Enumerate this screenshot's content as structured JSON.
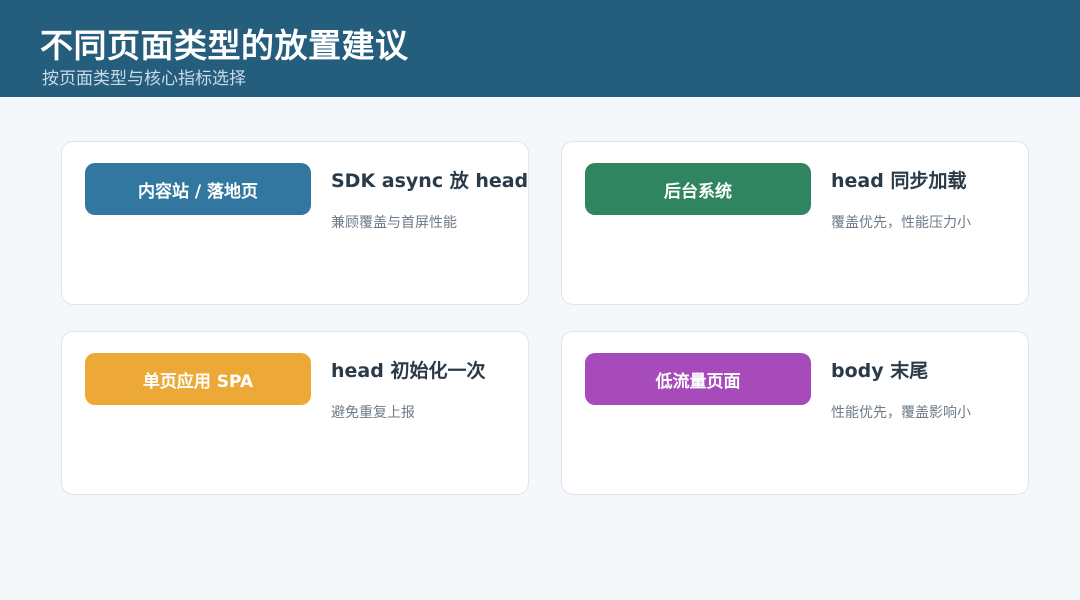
{
  "header": {
    "title": "不同页面类型的放置建议",
    "subtitle": "按页面类型与核心指标选择"
  },
  "cards": [
    {
      "tag": "内容站 / 落地页",
      "tag_color": "#32779f",
      "title": "SDK async 放 head",
      "desc": "兼顾覆盖与首屏性能"
    },
    {
      "tag": "后台系统",
      "tag_color": "#2f8560",
      "title": "head 同步加载",
      "desc": "覆盖优先，性能压力小"
    },
    {
      "tag": "单页应用 SPA",
      "tag_color": "#eca937",
      "title": "head 初始化一次",
      "desc": "避免重复上报"
    },
    {
      "tag": "低流量页面",
      "tag_color": "#a74bbb",
      "title": "body 末尾",
      "desc": "性能优先，覆盖影响小"
    }
  ]
}
